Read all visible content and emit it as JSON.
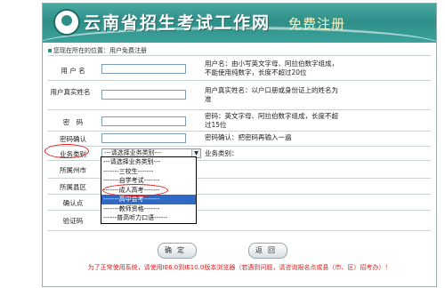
{
  "banner": {
    "site_title": "云南省招生考试工作网",
    "section_title": "免费注册"
  },
  "breadcrumb": "您现在所在的位置：用户免费注册",
  "form": {
    "username_label": "用 户 名",
    "username_tip": "用户名：由小写英文字母、阿拉伯数字组成，不能使用纯数字，长度不超过20位",
    "realname_label": "用户真实姓名",
    "realname_tip": "用户真实姓名：以户口册或身份证上的姓名为准",
    "password_label": "密　码",
    "password_tip": "密码：英文字母、阿拉伯数字组成，长度不超过15位",
    "confirm_label": "密码确认",
    "confirm_tip": "密码确认：把密码再输入一遍",
    "business_label": "业务类别",
    "business_value": "---请选择业务类别---",
    "business_tip": "业务类别：",
    "city_label": "所属州市",
    "county_label": "所属县区",
    "testpoint_label": "确认点",
    "captcha_label": "验证码"
  },
  "dropdown": {
    "options": [
      "---请选择业务类别---",
      "-------三校生-------",
      "-------自学考试-------",
      "-------成人高考-------",
      "-------高中会考-------",
      "-------教师资格-------",
      "------普高听力口语------"
    ],
    "highlighted_index": 4
  },
  "buttons": {
    "confirm": "确定",
    "back": "返回"
  },
  "notice": "为了正常使用系统，请使用IE6.0到IE10.0版本浏览器（若遇到问题，请咨询报名点或县（市、区）招考办）！",
  "colors": {
    "banner": "#2f8e88",
    "highlight": "#316ac5",
    "annotation": "#e02020"
  }
}
